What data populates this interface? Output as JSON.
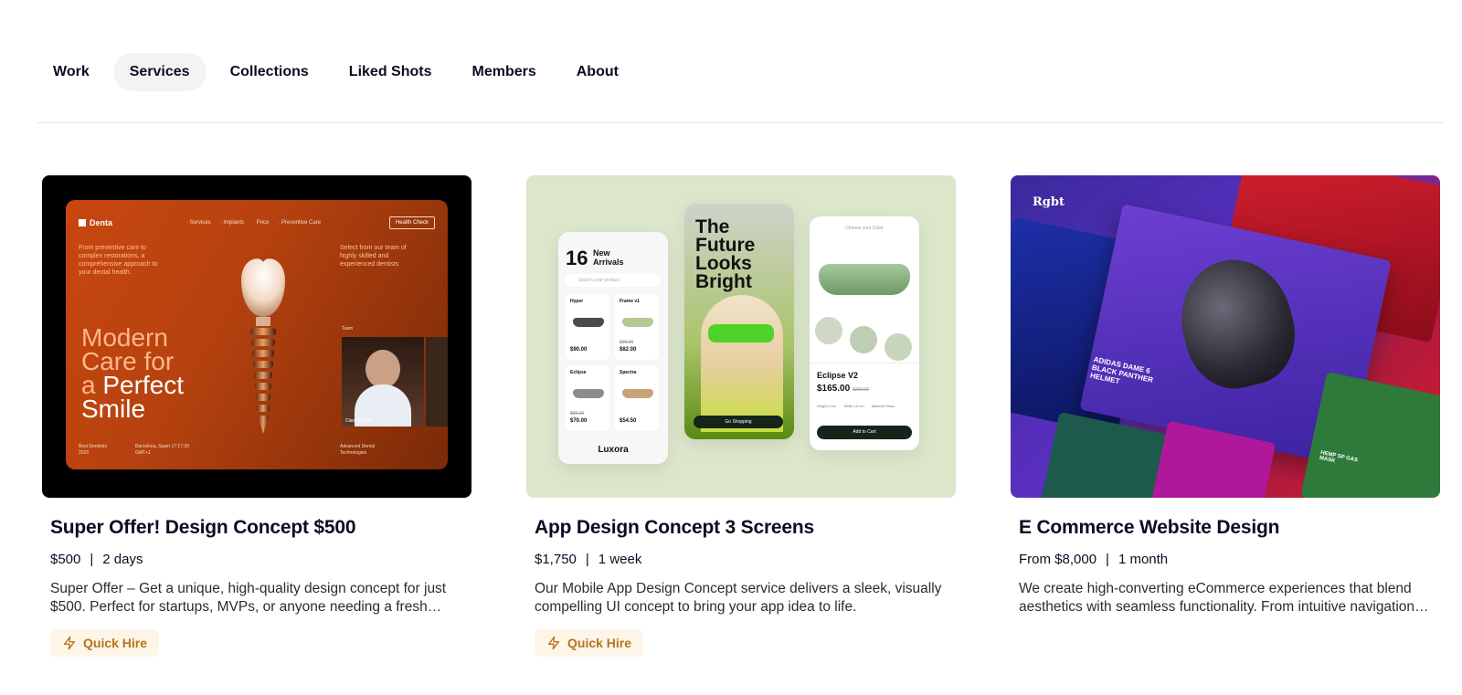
{
  "tabs": [
    {
      "label": "Work",
      "active": false
    },
    {
      "label": "Services",
      "active": true
    },
    {
      "label": "Collections",
      "active": false
    },
    {
      "label": "Liked Shots",
      "active": false
    },
    {
      "label": "Members",
      "active": false
    },
    {
      "label": "About",
      "active": false
    }
  ],
  "cards": [
    {
      "title": "Super Offer! Design Concept $500",
      "price": "$500",
      "separator": "|",
      "duration": "2 days",
      "description": "Super Offer – Get a unique, high-quality design concept for just $500. Perfect for startups, MVPs, or anyone needing a fresh visual direction.",
      "badge": "Quick Hire",
      "badge_icon": "lightning-icon",
      "thumb": {
        "logo": "Denta",
        "nav": [
          "· Services",
          "· Implants",
          "· Price",
          "· Preventive Care"
        ],
        "button": "Health Check",
        "intro": "From preventive care to complex restorations, a comprehensive approach to your dental health.",
        "team": "Select from our team of highly skilled and experienced dentists",
        "headline_1": "Modern",
        "headline_2": "Care for",
        "headline_3a": "a ",
        "headline_3b": "Perfect",
        "headline_4": "Smile",
        "photo_label": "Team",
        "person": "Clara Dallins",
        "footer_1": "Best Dentistry 2025",
        "footer_2": "Barcelona, Spain 17:17:20 GMT+1",
        "footer_3": "Advanced Dental Technologies"
      }
    },
    {
      "title": "App Design Concept 3 Screens",
      "price": "$1,750",
      "separator": "|",
      "duration": "1 week",
      "description": "Our Mobile App Design Concept service delivers a sleek, visually compelling UI concept to bring your app idea to life.",
      "badge": "Quick Hire",
      "badge_icon": "lightning-icon",
      "thumb": {
        "count": "16",
        "arrivals": "New Arrivals",
        "search": "Search your product",
        "items": [
          {
            "name": "Hyper",
            "price": "$90.00",
            "old": ""
          },
          {
            "name": "Frame v1",
            "price": "$82.00",
            "old": "$99.00"
          },
          {
            "name": "Eclipse",
            "price": "$70.00",
            "old": "$85.00"
          },
          {
            "name": "Spectra",
            "price": "$54.50",
            "old": ""
          }
        ],
        "brand": "Luxora",
        "tagline": "The Future Looks Bright",
        "go_button": "Go Shopping",
        "choose": "Choose your Color",
        "product": "Eclipse V2",
        "product_price": "$165.00",
        "product_old": "$200.00",
        "specs": [
          "Height 4 cm",
          "Width 15 cm",
          "Material Glass"
        ],
        "cart_button": "Add to Cart"
      }
    },
    {
      "title": "E Commerce Website Design",
      "price": "From $8,000",
      "separator": "|",
      "duration": "1 month",
      "description": "We create high-converting eCommerce experiences that blend aesthetics with seamless functionality. From intuitive navigation to checkout.",
      "badge": "",
      "thumb": {
        "logo": "Rgbt",
        "product": "ADIDAS DAME 6 BLACK PANTHER HELMET",
        "mask": "HEMP SP GAS MASK"
      }
    }
  ],
  "colors": {
    "text": "#0d0c22",
    "active_tab_bg": "#f3f3f4",
    "badge_bg": "#fdf5e8",
    "badge_text": "#b8741a"
  }
}
